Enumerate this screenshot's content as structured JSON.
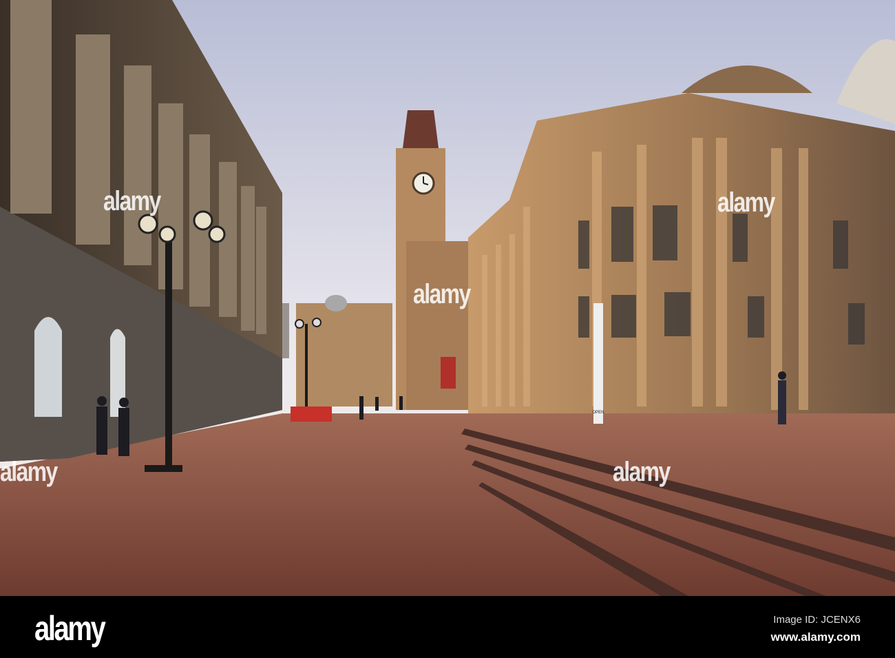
{
  "photo": {
    "signage": {
      "open_sign": "OPEN"
    },
    "watermark_text": "alamy"
  },
  "footer": {
    "logo": "alamy",
    "image_id": "Image ID: JCENX6",
    "url": "www.alamy.com"
  }
}
